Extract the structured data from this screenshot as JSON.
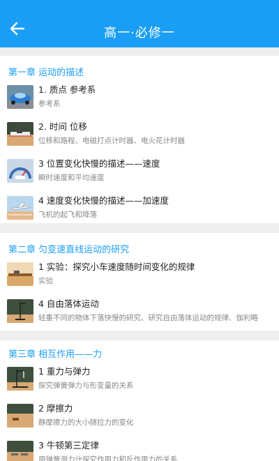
{
  "app_bar": {
    "title": "高一·必修一"
  },
  "chapters": [
    {
      "title": "第一章 运动的描述",
      "items": [
        {
          "title": "1. 质点 参考系",
          "subtitle": "参考系",
          "thumb": "car-thumbnail"
        },
        {
          "title": "2. 时间 位移",
          "subtitle": "位移和路程、电磁打点计时器、电火花计时器",
          "thumb": "timer-thumbnail"
        },
        {
          "title": "3 位置变化快慢的描述——速度",
          "subtitle": "瞬时速度和平均速度",
          "thumb": "speedometer-thumbnail"
        },
        {
          "title": "4 速度变化快慢的描述——加速度",
          "subtitle": "飞机的起飞和降落",
          "thumb": "airplane-thumbnail"
        }
      ]
    },
    {
      "title": "第二章 匀变速直线运动的研究",
      "items": [
        {
          "title": "1 实验：探究小车速度随时间变化的规律",
          "subtitle": "实验",
          "thumb": "cart-track-thumbnail"
        },
        {
          "title": "4 自由落体运动",
          "subtitle": "轻重不同的物体下落快慢的研究、研究自由落体运动的规律、伽利略",
          "thumb": "free-fall-thumbnail"
        }
      ]
    },
    {
      "title": "第三章 相互作用——力",
      "items": [
        {
          "title": "1 重力与弹力",
          "subtitle": "探究弹簧弹力与形变量的关系",
          "thumb": "spring-stand-thumbnail"
        },
        {
          "title": "2 摩擦力",
          "subtitle": "静摩擦力的大小随拉力的变化",
          "thumb": "friction-block-thumbnail"
        },
        {
          "title": "3 牛顿第三定律",
          "subtitle": "用弹簧测力计探究作用力和反作用力的关系",
          "thumb": "newton-third-thumbnail"
        }
      ]
    }
  ],
  "colors": {
    "app_bar": "#1a9ef5",
    "chapter_title": "#1a9ef5",
    "background": "#eeeeee"
  }
}
